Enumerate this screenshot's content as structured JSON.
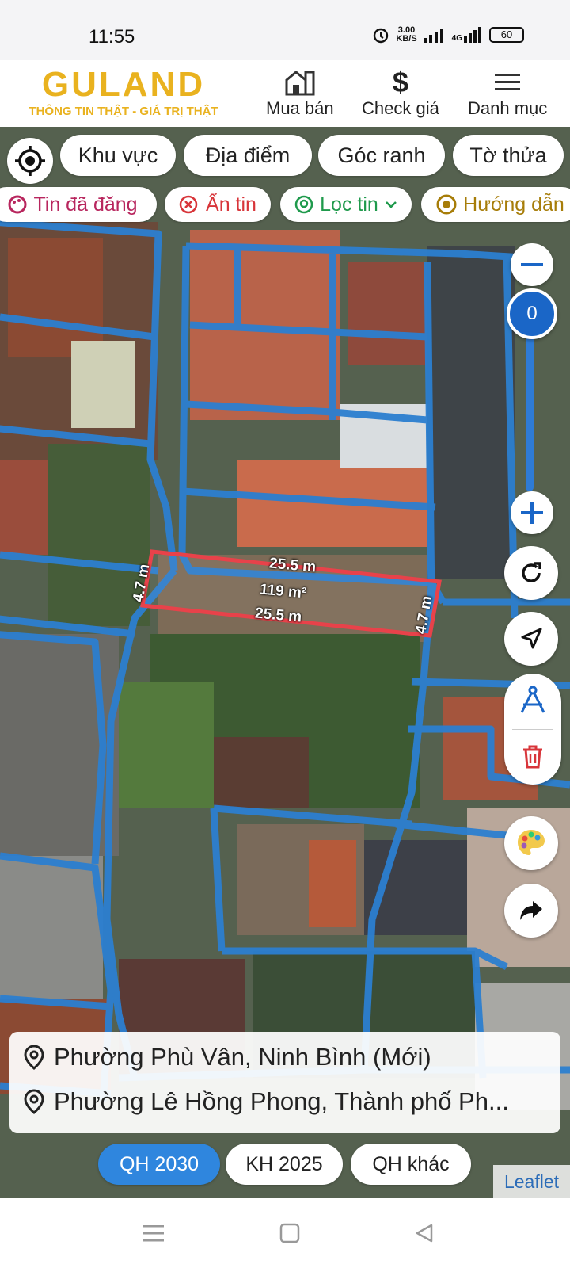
{
  "status": {
    "time": "11:55",
    "net_speed_value": "3.00",
    "net_speed_unit": "KB/S",
    "network": "4G",
    "battery": "60"
  },
  "header": {
    "logo_text": "GULAND",
    "tagline": "THÔNG TIN THẬT - GIÁ TRỊ THẬT",
    "nav": [
      {
        "label": "Mua bán",
        "icon": "building-icon"
      },
      {
        "label": "Check giá",
        "icon": "dollar-icon"
      },
      {
        "label": "Danh mục",
        "icon": "menu-icon"
      }
    ]
  },
  "filters": [
    "Khu vực",
    "Địa điểm",
    "Góc ranh",
    "Tờ thửa"
  ],
  "actions": [
    {
      "label": "Tin đã đăng",
      "icon": "palette-icon",
      "color": "#b8265e"
    },
    {
      "label": "Ẩn tin",
      "icon": "close-circle-icon",
      "color": "#d8353a"
    },
    {
      "label": "Lọc tin",
      "icon": "location-pin-icon",
      "color": "#1f9a4c"
    },
    {
      "label": "Hướng dẫn",
      "icon": "play-circle-icon",
      "color": "#a77d09"
    }
  ],
  "map": {
    "zoom_value": "0",
    "plot": {
      "top_length": "25.5 m",
      "bottom_length": "25.5 m",
      "left_width": "4.7 m",
      "right_width": "4.7 m",
      "area": "119 m²"
    },
    "addresses": [
      "Phường Phù Vân, Ninh Bình (Mới)",
      "Phường Lê Hồng Phong, Thành phố Ph..."
    ],
    "plan_layers": [
      {
        "label": "QH 2030",
        "active": true
      },
      {
        "label": "KH 2025",
        "active": false
      },
      {
        "label": "QH khác",
        "active": false
      }
    ],
    "attribution": "Leaflet"
  },
  "colors": {
    "accent": "#2f86de",
    "brand": "#e9b21f",
    "parcel_line": "#2c7fd0",
    "plot_outline": "#e8424a"
  }
}
